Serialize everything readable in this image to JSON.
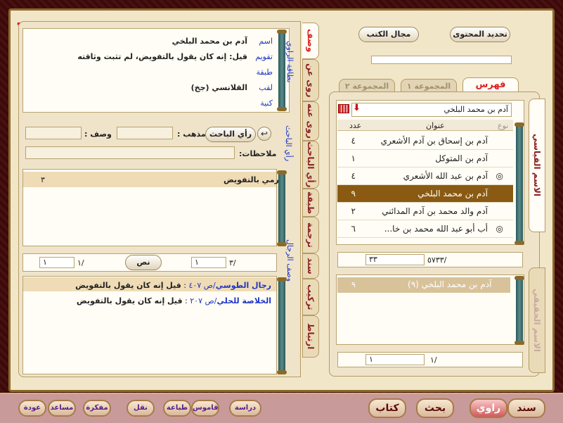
{
  "top_buttons": {
    "update": "تحديد المحتوى",
    "books": "مجال الكتب"
  },
  "left_tabs": {
    "index": "فهرس",
    "group1": "المجموعة ١",
    "group2": "المجموعة ٢"
  },
  "search": {
    "value": "آدم بن محمد البلخي"
  },
  "table": {
    "headers": {
      "type": "نوع",
      "title": "عنوان",
      "count": "عدد"
    },
    "rows": [
      {
        "title": "آدم بن إسحاق بن آدم الأشعري",
        "count": "٤",
        "mark": ""
      },
      {
        "title": "آدم بن المتوكل",
        "count": "١",
        "mark": ""
      },
      {
        "title": "آدم بن عبد الله الأشعري",
        "count": "٤",
        "mark": "◎"
      },
      {
        "title": "آدم بن محمد البلخي",
        "count": "٩",
        "mark": ""
      },
      {
        "title": "آدم والد محمد بن آدم المدائني",
        "count": "٢",
        "mark": ""
      },
      {
        "title": "أب أبو عبد الله محمد بن خا...",
        "count": "٦",
        "mark": "◎"
      }
    ]
  },
  "counter_top": {
    "total": "/٥٧٣٣",
    "current": "٣٣"
  },
  "real_name": {
    "title": "آدم بن محمد البلخي (٩)",
    "count": "٩"
  },
  "counter_bottom": {
    "total": "/١",
    "current": "١"
  },
  "side_labels": {
    "standard": "الاسم القياسي",
    "real": "الاسم الحقيقي"
  },
  "vertical_tabs": [
    "وصف",
    "روى عن",
    "روى عنه",
    "رأي الباحث",
    "طبقة",
    "ترجمة",
    "سند",
    "تركيب",
    "ارتباط"
  ],
  "narrator": {
    "card_label": "بطاقة الراوي",
    "fields": [
      {
        "label": "اسم",
        "value": "آدم بن محمد البلخي"
      },
      {
        "label": "تقويم",
        "value": "قيل: إنه كان يقول بالتفويض، لم تثبت وثاقته"
      },
      {
        "label": "طبقة",
        "value": ""
      },
      {
        "label": "لقب",
        "value": "القلانسي (جخ)"
      },
      {
        "label": "كنية",
        "value": ""
      }
    ]
  },
  "researcher": {
    "side": "رأي الباحث",
    "button": "رأي الباحث",
    "madhhab": "مذهب :",
    "wasf": "وصف :",
    "notes": "ملاحظات:"
  },
  "description": {
    "side": "وصف الرجال",
    "text": "رمي بالتفويض",
    "count": "٣"
  },
  "pager1": {
    "total": "/٣",
    "current": "١"
  },
  "pager2": {
    "total": "/١",
    "current": "١"
  },
  "text_btn": "نص",
  "sources": [
    {
      "book": "رجال الطوسي",
      "page": "/ص ٤٠٧",
      "text": "قيل إنه كان يقول بالتفويض"
    },
    {
      "book": "الخلاصة للحلي",
      "page": "/ص ٢٠٧",
      "text": "قيل إنه كان يقول بالتفويض"
    }
  ],
  "bottom_big": [
    "سند",
    "راوي",
    "بحث",
    "كتاب"
  ],
  "bottom_small": [
    "دراسة",
    "قاموس",
    "طباعة",
    "نقل",
    "مفكرة",
    "مساعد",
    "عودة"
  ]
}
